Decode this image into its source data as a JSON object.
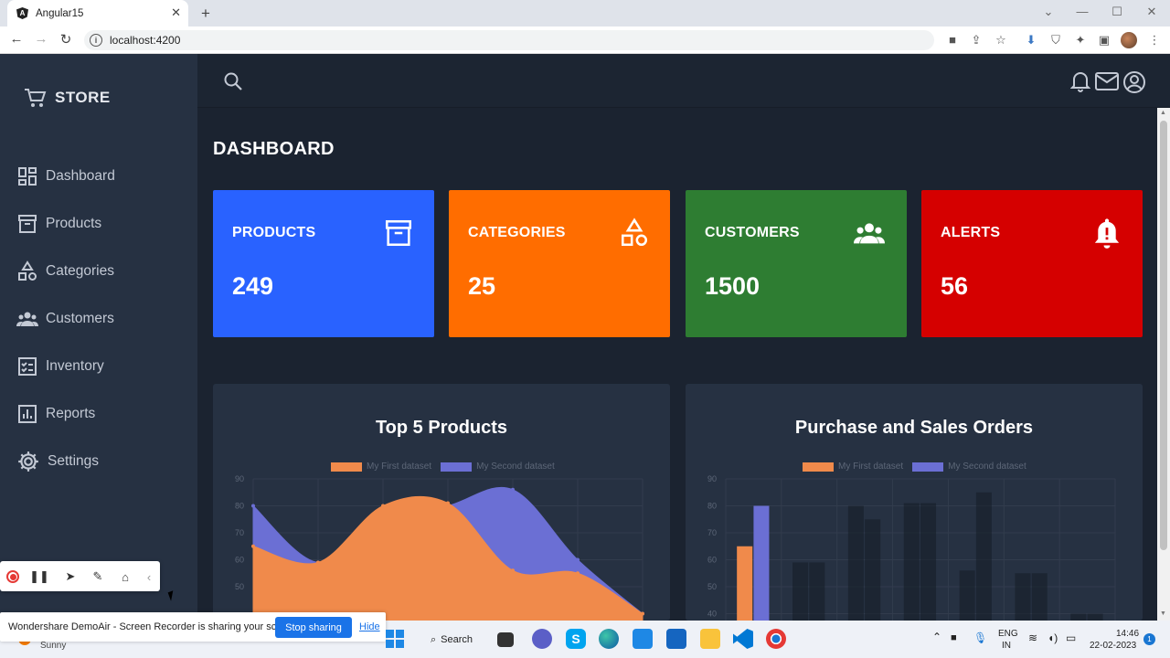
{
  "browser": {
    "tab_title": "Angular15",
    "url": "localhost:4200"
  },
  "sidebar": {
    "brand": "STORE",
    "items": [
      {
        "label": "Dashboard",
        "icon": "dashboard-icon"
      },
      {
        "label": "Products",
        "icon": "archive-icon"
      },
      {
        "label": "Categories",
        "icon": "shapes-icon"
      },
      {
        "label": "Customers",
        "icon": "users-icon"
      },
      {
        "label": "Inventory",
        "icon": "checklist-icon"
      },
      {
        "label": "Reports",
        "icon": "bar-chart-icon"
      },
      {
        "label": "Settings",
        "icon": "gear-icon"
      }
    ]
  },
  "header": {
    "icons": [
      "search-icon",
      "bell-icon",
      "mail-icon",
      "user-circle-icon"
    ]
  },
  "main": {
    "title": "DASHBOARD",
    "cards": [
      {
        "label": "PRODUCTS",
        "value": "249",
        "color": "#2962ff",
        "icon": "archive-icon"
      },
      {
        "label": "CATEGORIES",
        "value": "25",
        "color": "#ff6d00",
        "icon": "shapes-icon"
      },
      {
        "label": "CUSTOMERS",
        "value": "1500",
        "color": "#2e7d32",
        "icon": "users-icon"
      },
      {
        "label": "ALERTS",
        "value": "56",
        "color": "#d50000",
        "icon": "bell-alert-icon"
      }
    ]
  },
  "chart_data": [
    {
      "type": "area",
      "title": "Top 5 Products",
      "ylim": [
        40,
        90
      ],
      "yticks": [
        "90",
        "80",
        "70",
        "60",
        "50"
      ],
      "legend_position": "top",
      "series": [
        {
          "name": "My First dataset",
          "color": "#f08a4b",
          "values": [
            65,
            59,
            80,
            81,
            56,
            55,
            40
          ]
        },
        {
          "name": "My Second dataset",
          "color": "#6b6fd4",
          "values": [
            80,
            59,
            75,
            80,
            86,
            60,
            40
          ]
        }
      ]
    },
    {
      "type": "bar",
      "title": "Purchase and Sales Orders",
      "ylim": [
        40,
        90
      ],
      "yticks": [
        "90",
        "80",
        "70",
        "60",
        "50",
        "40"
      ],
      "legend_position": "top",
      "series": [
        {
          "name": "My First dataset",
          "color": "#f08a4b",
          "values": [
            65,
            59,
            80,
            81,
            56,
            55,
            40
          ]
        },
        {
          "name": "My Second dataset",
          "color": "#6b6fd4",
          "values": [
            80,
            59,
            75,
            81,
            85,
            55,
            40
          ]
        }
      ]
    }
  ],
  "recorder": {
    "message": "Wondershare DemoAir - Screen Recorder is sharing your screen.",
    "stop_label": "Stop sharing",
    "hide_label": "Hide"
  },
  "taskbar": {
    "user": "Sunny",
    "search_label": "Search",
    "lang": "ENG",
    "region": "IN",
    "time": "14:46",
    "date": "22-02-2023",
    "notif_count": "1"
  }
}
